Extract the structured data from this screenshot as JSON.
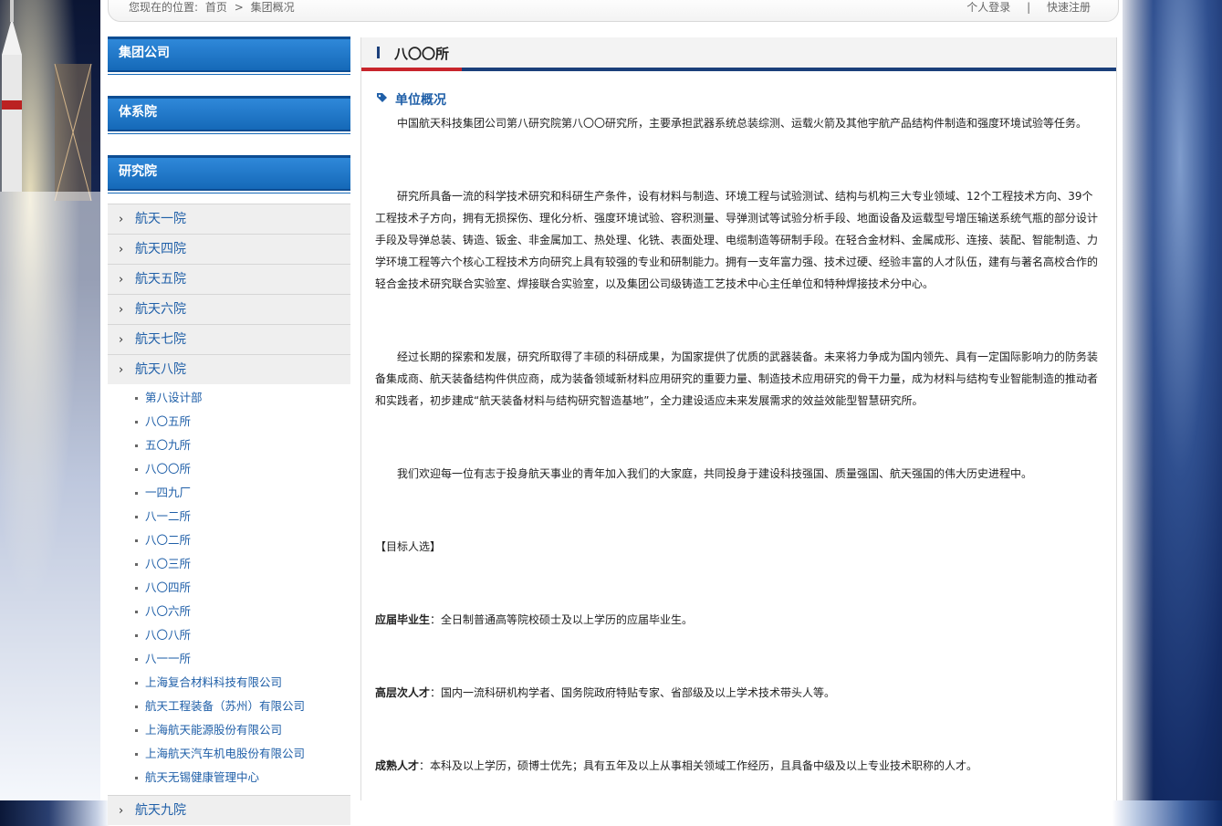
{
  "breadcrumb": {
    "prefix": "您现在的位置:",
    "home": "首页",
    "sep": ">",
    "current": "集团概况"
  },
  "toplinks": {
    "login": "个人登录",
    "divider": "|",
    "register": "快速注册"
  },
  "sidebar": {
    "groups": [
      "集团公司",
      "体系院",
      "研究院"
    ],
    "categories": [
      "航天一院",
      "航天四院",
      "航天五院",
      "航天六院",
      "航天七院",
      "航天八院"
    ],
    "sub_items": [
      "第八设计部",
      "八〇五所",
      "五〇九所",
      "八〇〇所",
      "一四九厂",
      "八一二所",
      "八〇二所",
      "八〇三所",
      "八〇四所",
      "八〇六所",
      "八〇八所",
      "八一一所",
      "上海复合材料科技有限公司",
      "航天工程装备（苏州）有限公司",
      "上海航天能源股份有限公司",
      "上海航天汽车机电股份有限公司",
      "航天无锡健康管理中心"
    ],
    "last_category": "航天九院"
  },
  "content": {
    "title": "八〇〇所",
    "section": "单位概况",
    "p1": "中国航天科技集团公司第八研究院第八〇〇研究所，主要承担武器系统总装综测、运载火箭及其他宇航产品结构件制造和强度环境试验等任务。",
    "p2": "研究所具备一流的科学技术研究和科研生产条件，设有材料与制造、环境工程与试验测试、结构与机构三大专业领域、12个工程技术方向、39个工程技术子方向，拥有无损探伤、理化分析、强度环境试验、容积测量、导弹测试等试验分析手段、地面设备及运载型号增压输送系统气瓶的部分设计手段及导弹总装、铸造、钣金、非金属加工、热处理、化铣、表面处理、电缆制造等研制手段。在轻合金材料、金属成形、连接、装配、智能制造、力学环境工程等六个核心工程技术方向研究上具有较强的专业和研制能力。拥有一支年富力强、技术过硬、经验丰富的人才队伍，建有与著名高校合作的轻合金技术研究联合实验室、焊接联合实验室，以及集团公司级铸造工艺技术中心主任单位和特种焊接技术分中心。",
    "p3": "经过长期的探索和发展，研究所取得了丰硕的科研成果，为国家提供了优质的武器装备。未来将力争成为国内领先、具有一定国际影响力的防务装备集成商、航天装备结构件供应商，成为装备领域新材料应用研究的重要力量、制造技术应用研究的骨干力量，成为材料与结构专业智能制造的推动者和实践者，初步建成“航天装备材料与结构研究智造基地”，全力建设适应未来发展需求的效益效能型智慧研究所。",
    "p4": "我们欢迎每一位有志于投身航天事业的青年加入我们的大家庭，共同投身于建设科技强国、质量强国、航天强国的伟大历史进程中。",
    "target": "【目标人选】",
    "t1_label": "应届毕业生",
    "t1_text": "：全日制普通高等院校硕士及以上学历的应届毕业生。",
    "t2_label": "高层次人才",
    "t2_text": "：国内一流科研机构学者、国务院政府特贴专家、省部级及以上学术技术带头人等。",
    "t3_label": "成熟人才",
    "t3_text": "：本科及以上学历，硕博士优先；具有五年及以上从事相关领域工作经历，且具备中级及以上专业技术职称的人才。"
  },
  "colors": {
    "accent_blue": "#1f5fa8",
    "header_blue": "#1569b8",
    "accent_red": "#c8252c",
    "navy": "#1b3f7a"
  }
}
